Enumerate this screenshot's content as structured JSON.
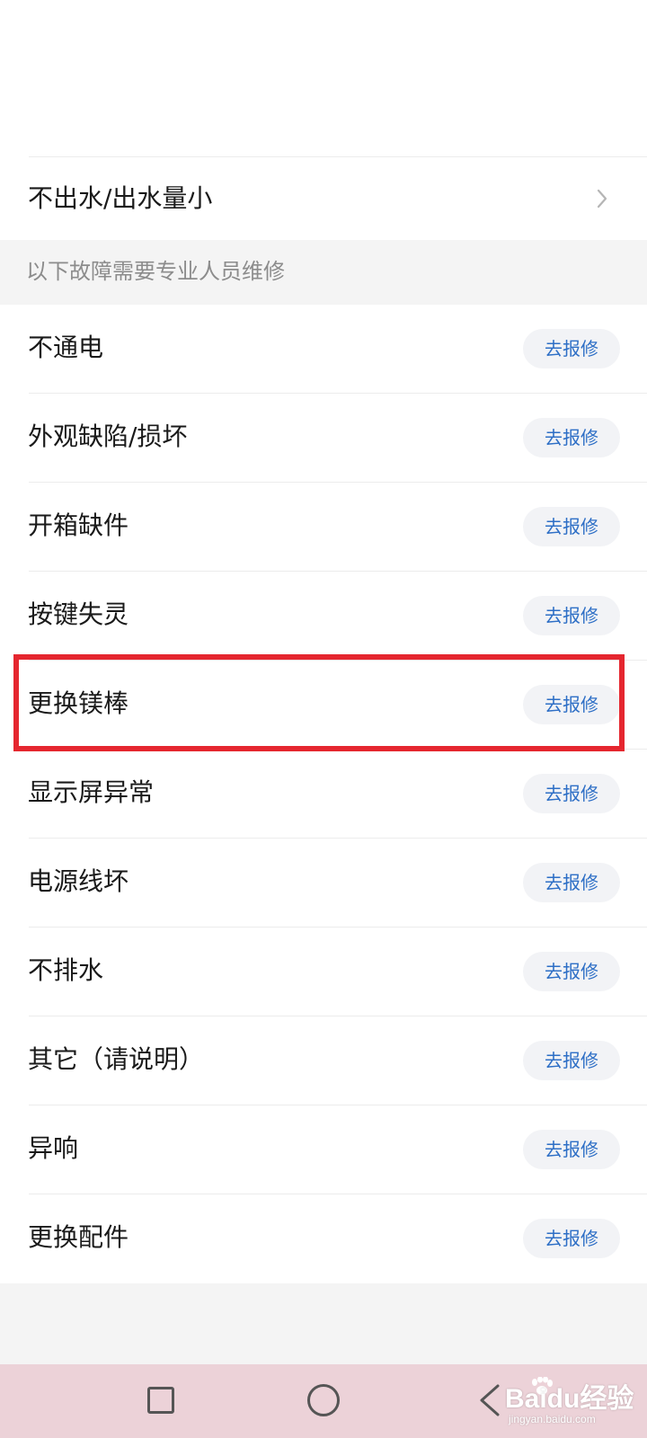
{
  "diy_item": {
    "label": "不出水/出水量小",
    "icon": "chevron-right-icon"
  },
  "section": {
    "header": "以下故障需要专业人员维修"
  },
  "repair_button_label": "去报修",
  "faults": [
    "不通电",
    "外观缺陷/损坏",
    "开箱缺件",
    "按键失灵",
    "更换镁棒",
    "显示屏异常",
    "电源线坏",
    "不排水",
    "其它（请说明）",
    "异响",
    "更换配件"
  ],
  "highlighted_fault": "更换镁棒",
  "annotation_color": "#e5262f",
  "accent_color": "#2e6fc6",
  "nav_bar": {
    "icons": [
      "recent-apps-icon",
      "home-icon",
      "back-icon"
    ]
  },
  "watermark": {
    "brand": "Baidu经验",
    "url": "jingyan.baidu.com"
  }
}
